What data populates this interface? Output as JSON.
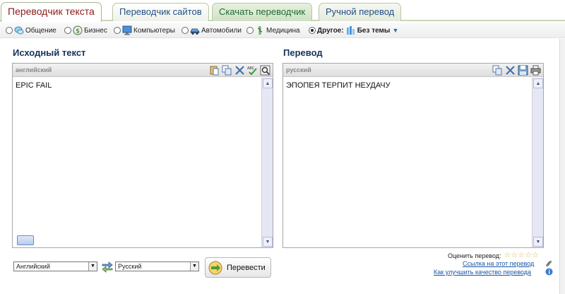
{
  "tabs": [
    {
      "label": "Переводчик текста",
      "active": true
    },
    {
      "label": "Переводчик сайтов",
      "active": false
    },
    {
      "label": "Скачать переводчик",
      "active": false
    },
    {
      "label": "Ручной перевод",
      "active": false
    }
  ],
  "topics": {
    "items": [
      {
        "label": "Общение",
        "icon": "chat-bubbles-icon"
      },
      {
        "label": "Бизнес",
        "icon": "dollar-coin-icon"
      },
      {
        "label": "Компьютеры",
        "icon": "monitor-icon"
      },
      {
        "label": "Автомобили",
        "icon": "car-icon"
      },
      {
        "label": "Медицина",
        "icon": "medical-icon"
      }
    ],
    "other_label": "Другое:",
    "other_selected": "Без темы",
    "other_icon": "bar-chart-icon"
  },
  "source": {
    "title": "Исходный текст",
    "language": "английский",
    "text": "EPIC FAIL",
    "tool_icons": [
      "paste-icon",
      "copy-icon",
      "clear-icon",
      "spellcheck-icon",
      "dictionary-search-icon"
    ]
  },
  "target": {
    "title": "Перевод",
    "language": "русский",
    "text": "ЭПОПЕЯ ТЕРПИТ НЕУДАЧУ",
    "tool_icons": [
      "copy-icon",
      "clear-icon",
      "save-icon",
      "print-icon"
    ]
  },
  "controls": {
    "source_language": "Английский",
    "target_language": "Русский",
    "translate_label": "Перевести"
  },
  "rating": {
    "label": "Оценить перевод:",
    "stars": 5,
    "link_label": "Ссылка на этот перевод",
    "improve_label": "Как улучшить качество перевода"
  },
  "colors": {
    "accent": "#13325c",
    "active_tab_text": "#8d1a1a",
    "link": "#1a56a8",
    "scrollbar": "#e6e7f4"
  }
}
